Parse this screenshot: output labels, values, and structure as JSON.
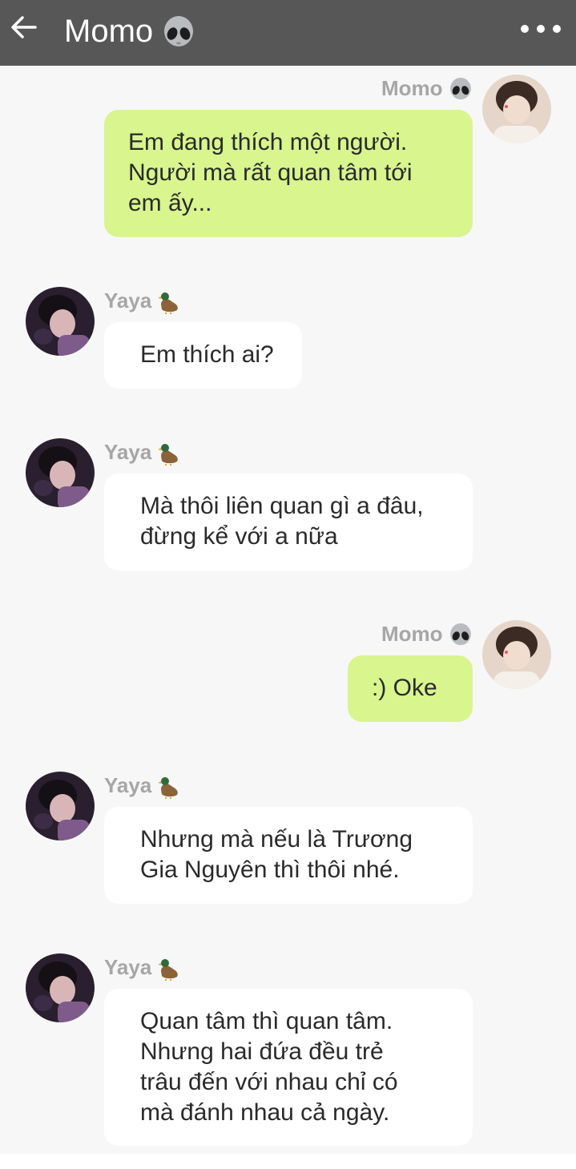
{
  "header": {
    "title": "Momo",
    "title_emoji": "alien-icon",
    "back": "back-arrow-icon",
    "more": "more-dots-icon"
  },
  "messages": [
    {
      "sender": "Momo",
      "emoji": "alien-icon",
      "side": "right",
      "text": "Em đang thích một người.\nNgười mà rất quan tâm tới\nem ấy..."
    },
    {
      "sender": "Yaya",
      "emoji": "duck-icon",
      "side": "left",
      "text": "Em thích ai?"
    },
    {
      "sender": "Yaya",
      "emoji": "duck-icon",
      "side": "left",
      "text": "Mà thôi liên quan gì a đâu,\nđừng kể với a nữa"
    },
    {
      "sender": "Momo",
      "emoji": "alien-icon",
      "side": "right",
      "text": ":) Oke"
    },
    {
      "sender": "Yaya",
      "emoji": "duck-icon",
      "side": "left",
      "text": "Nhưng mà nếu là Trương\nGia Nguyên thì thôi nhé."
    },
    {
      "sender": "Yaya",
      "emoji": "duck-icon",
      "side": "left",
      "text": "Quan tâm thì quan tâm.\nNhưng hai đứa đều trẻ\ntrâu đến với nhau chỉ có\nmà đánh nhau cả ngày."
    }
  ],
  "colors": {
    "header_bg": "#575757",
    "my_bubble": "#d8f58e",
    "other_bubble": "#ffffff",
    "background": "#f7f7f7",
    "name_text": "#a6a6a6"
  }
}
